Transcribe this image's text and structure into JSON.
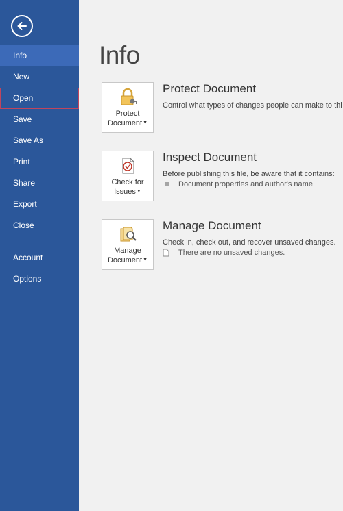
{
  "sidebar": {
    "items": [
      {
        "label": "Info",
        "active": true
      },
      {
        "label": "New"
      },
      {
        "label": "Open",
        "outlined": true
      },
      {
        "label": "Save"
      },
      {
        "label": "Save As"
      },
      {
        "label": "Print"
      },
      {
        "label": "Share"
      },
      {
        "label": "Export"
      },
      {
        "label": "Close"
      }
    ],
    "bottom_items": [
      {
        "label": "Account"
      },
      {
        "label": "Options"
      }
    ],
    "colors": {
      "background": "#2b579a",
      "active": "#3c6ab8",
      "hover_outline": "#c0455d"
    }
  },
  "main": {
    "title": "Info",
    "sections": [
      {
        "button_line1": "Protect",
        "button_line2": "Document",
        "icon": "lock-icon",
        "title": "Protect Document",
        "description": "Control what types of changes people can make to thi"
      },
      {
        "button_line1": "Check for",
        "button_line2": "Issues",
        "icon": "inspect-document-icon",
        "title": "Inspect Document",
        "description": "Before publishing this file, be aware that it contains:",
        "bullet": "Document properties and author's name"
      },
      {
        "button_line1": "Manage",
        "button_line2": "Document",
        "icon": "manage-document-icon",
        "title": "Manage Document",
        "description": "Check in, check out, and recover unsaved changes.",
        "bullet": "There are no unsaved changes."
      }
    ]
  }
}
